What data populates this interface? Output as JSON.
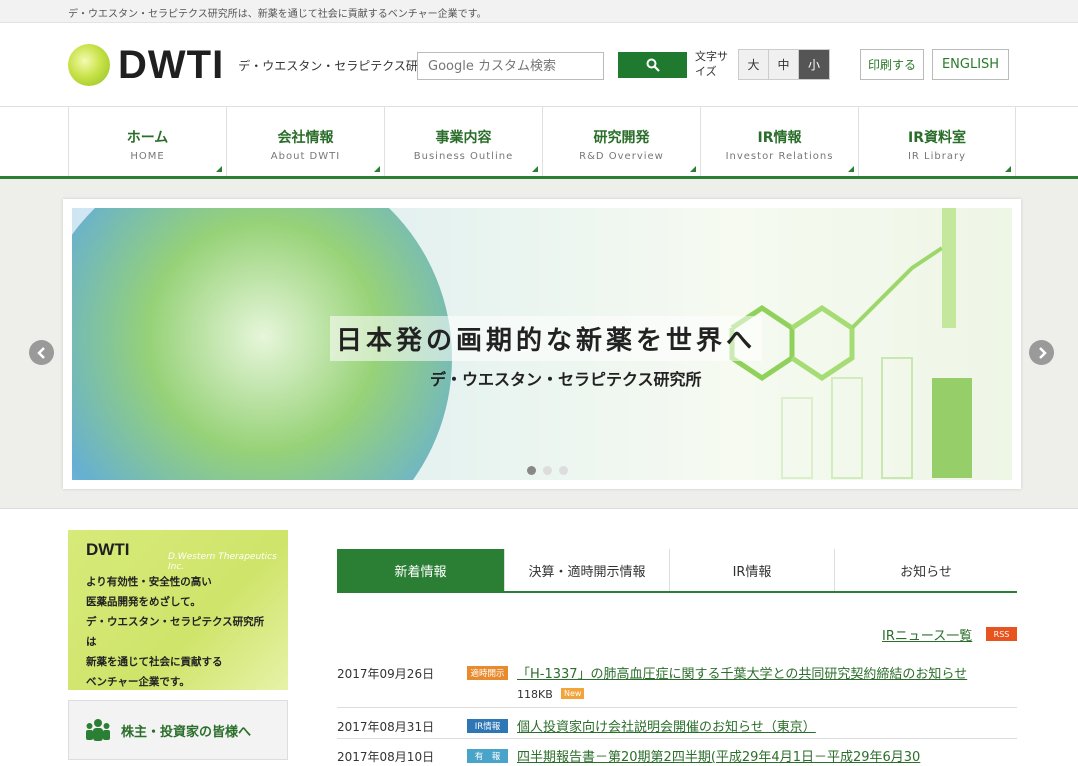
{
  "tagline": "デ・ウエスタン・セラピテクス研究所は、新薬を通じて社会に貢献するベンチャー企業です。",
  "header": {
    "logo_text": "DWTI",
    "logo_sub": "デ・ウエスタン・セラピテクス研究所",
    "search_placeholder": "Google カスタム検索",
    "textsize_label": "文字サイズ",
    "sizes": [
      "大",
      "中",
      "小"
    ],
    "print_label": "印刷する",
    "english_label": "ENGLISH"
  },
  "nav": [
    {
      "jp": "ホーム",
      "en": "HOME"
    },
    {
      "jp": "会社情報",
      "en": "About DWTI"
    },
    {
      "jp": "事業内容",
      "en": "Business Outline"
    },
    {
      "jp": "研究開発",
      "en": "R&D Overview"
    },
    {
      "jp": "IR情報",
      "en": "Investor Relations"
    },
    {
      "jp": "IR資料室",
      "en": "IR Library"
    }
  ],
  "slider": {
    "headline": "日本発の画期的な新薬を世界へ",
    "sub": "デ・ウエスタン・セラピテクス研究所"
  },
  "promo": {
    "title": "DWTI",
    "band": "D.Western Therapeutics Inc.",
    "lines": [
      "より有効性・安全性の高い",
      "医薬品開発をめざして。",
      "デ・ウエスタン・セラピテクス研究所は",
      "新薬を通じて社会に貢献する",
      "ベンチャー企業です。"
    ]
  },
  "investor_label": "株主・投資家の皆様へ",
  "tabs": [
    "新着情報",
    "決算・適時開示情報",
    "IR情報",
    "お知らせ"
  ],
  "news_list_label": "IRニュース一覧",
  "rss_label": "RSS",
  "colors": {
    "accent": "#2b7f34",
    "cat_timely": "#e88a2e",
    "cat_ir": "#2f76b5",
    "cat_report": "#4aa3c8"
  },
  "news": [
    {
      "date": "2017年09月26日",
      "category": "適時開示",
      "title": "「H-1337」の肺高血圧症に関する千葉大学との共同研究契約締結のお知らせ",
      "size": "118KB",
      "new": "New"
    },
    {
      "date": "2017年08月31日",
      "category": "IR情報",
      "title": "個人投資家向け会社説明会開催のお知らせ（東京）"
    },
    {
      "date": "2017年08月10日",
      "category": "有　報",
      "title": "四半期報告書－第20期第2四半期(平成29年4月1日－平成29年6月30"
    }
  ]
}
